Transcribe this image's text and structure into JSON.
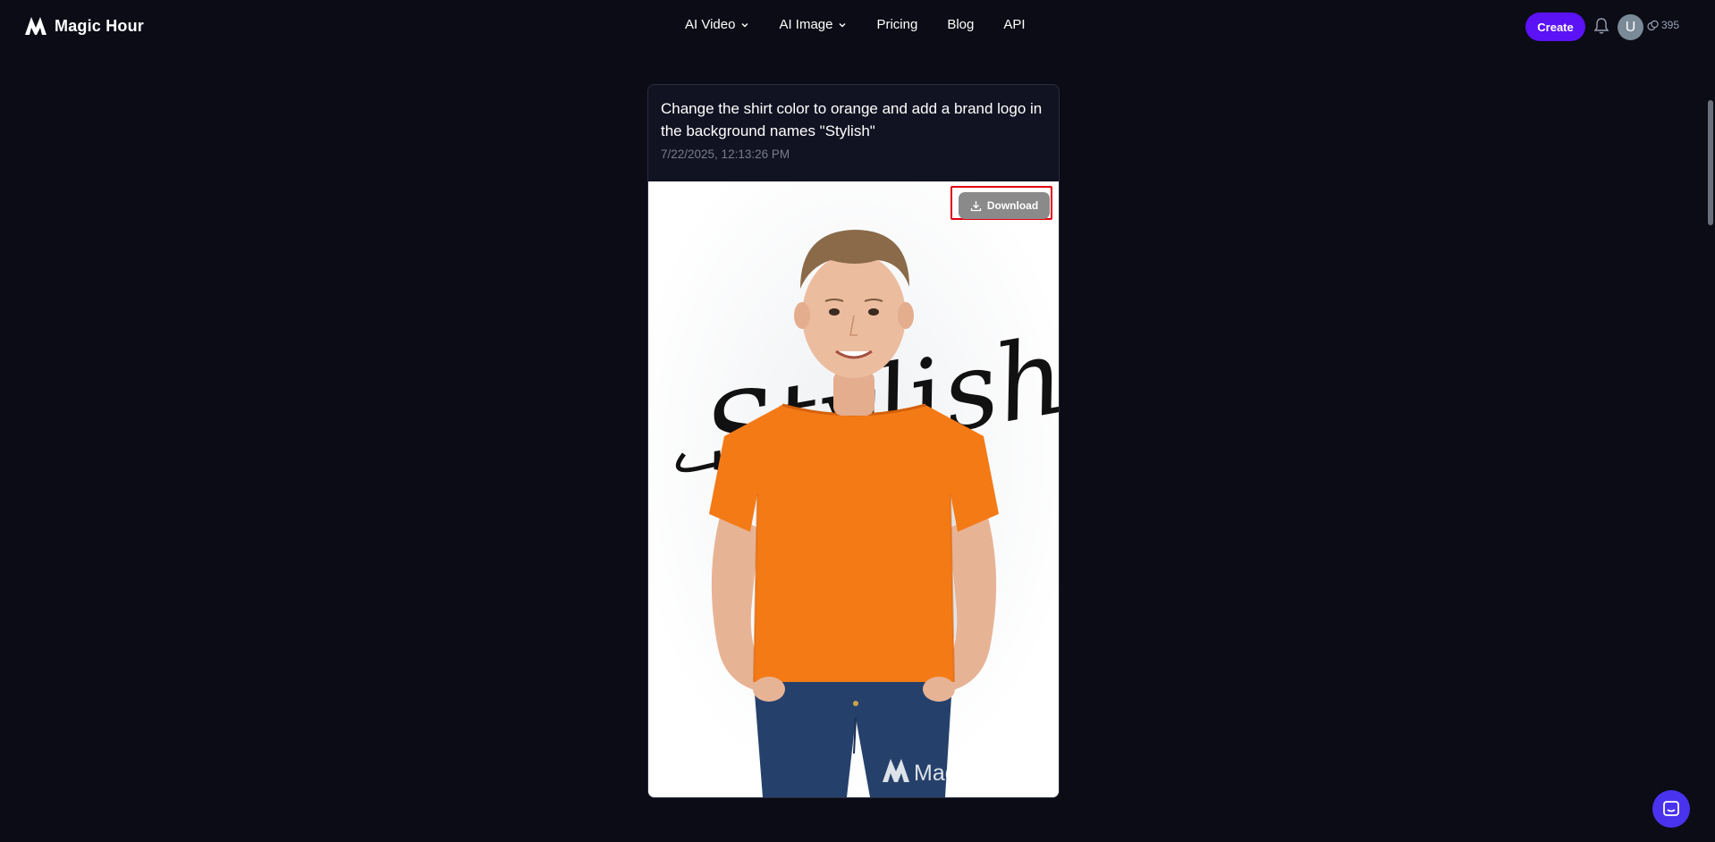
{
  "header": {
    "brand_name": "Magic Hour",
    "nav": [
      {
        "label": "AI Video",
        "has_dropdown": true
      },
      {
        "label": "AI Image",
        "has_dropdown": true
      },
      {
        "label": "Pricing",
        "has_dropdown": false
      },
      {
        "label": "Blog",
        "has_dropdown": false
      },
      {
        "label": "API",
        "has_dropdown": false
      }
    ],
    "create_label": "Create",
    "avatar_initial": "U",
    "credits": "395",
    "icons": {
      "bell": "bell-icon",
      "credits": "coins-icon",
      "logo": "magic-hour-logo"
    }
  },
  "card": {
    "prompt": "Change the shirt color to orange and add a brand logo in the background names \"Stylish\"",
    "timestamp": "7/22/2025, 12:13:26 PM",
    "download_label": "Download",
    "image": {
      "description_icon": "generated-image",
      "background_text": "Stylish",
      "watermark": "Magic Hour"
    }
  },
  "colors": {
    "page_bg": "#0b0c16",
    "card_bg": "#121322",
    "accent": "#5b12f5",
    "download_btn": "#8a8a8a",
    "highlight": "#e0000f",
    "shirt": "#f47a16",
    "chat": "#4a33ef"
  }
}
